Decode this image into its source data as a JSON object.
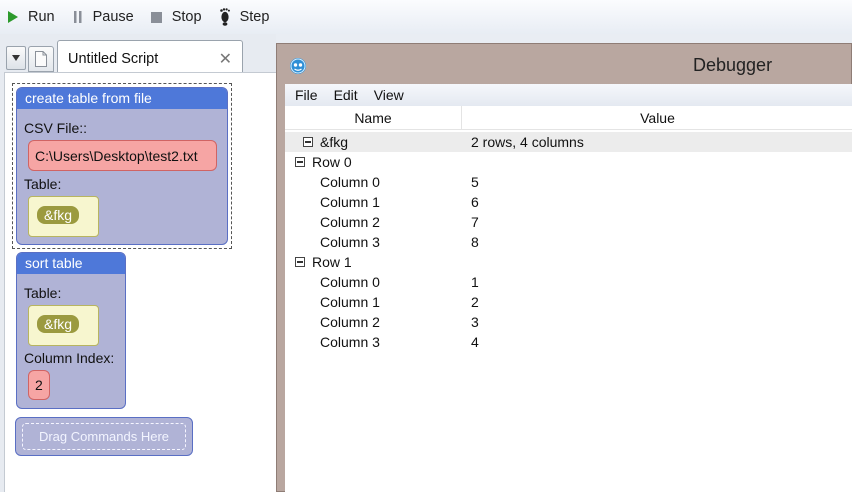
{
  "toolbar": {
    "run_label": "Run",
    "pause_label": "Pause",
    "stop_label": "Stop",
    "step_label": "Step",
    "run_icon_color": "#2c9a2c"
  },
  "tabs": {
    "active_title": "Untitled Script",
    "close_glyph": "✕"
  },
  "blocks": {
    "create_table": {
      "title": "create table from file",
      "csv_label": "CSV File::",
      "csv_value": "C:\\Users\\Desktop\\test2.txt",
      "table_label": "Table:",
      "table_var": "&fkg"
    },
    "sort_table": {
      "title": "sort table",
      "table_label": "Table:",
      "table_var": "&fkg",
      "column_label": "Column Index:",
      "column_value": "2"
    },
    "drag_placeholder": "Drag Commands Here"
  },
  "debugger": {
    "title": "Debugger",
    "menu": [
      "File",
      "Edit",
      "View"
    ],
    "columns": {
      "name": "Name",
      "value": "Value"
    },
    "rows": [
      {
        "name": "&fkg",
        "value": "2 rows, 4 columns",
        "level": 0,
        "expandable": true
      },
      {
        "name": "Row 0",
        "value": "",
        "level": 0,
        "expandable": true
      },
      {
        "name": "Column 0",
        "value": "5",
        "level": 1,
        "expandable": false
      },
      {
        "name": "Column 1",
        "value": "6",
        "level": 1,
        "expandable": false
      },
      {
        "name": "Column 2",
        "value": "7",
        "level": 1,
        "expandable": false
      },
      {
        "name": "Column 3",
        "value": "8",
        "level": 1,
        "expandable": false
      },
      {
        "name": "Row 1",
        "value": "",
        "level": 0,
        "expandable": true
      },
      {
        "name": "Column 0",
        "value": "1",
        "level": 1,
        "expandable": false
      },
      {
        "name": "Column 1",
        "value": "2",
        "level": 1,
        "expandable": false
      },
      {
        "name": "Column 2",
        "value": "3",
        "level": 1,
        "expandable": false
      },
      {
        "name": "Column 3",
        "value": "4",
        "level": 1,
        "expandable": false
      }
    ]
  }
}
